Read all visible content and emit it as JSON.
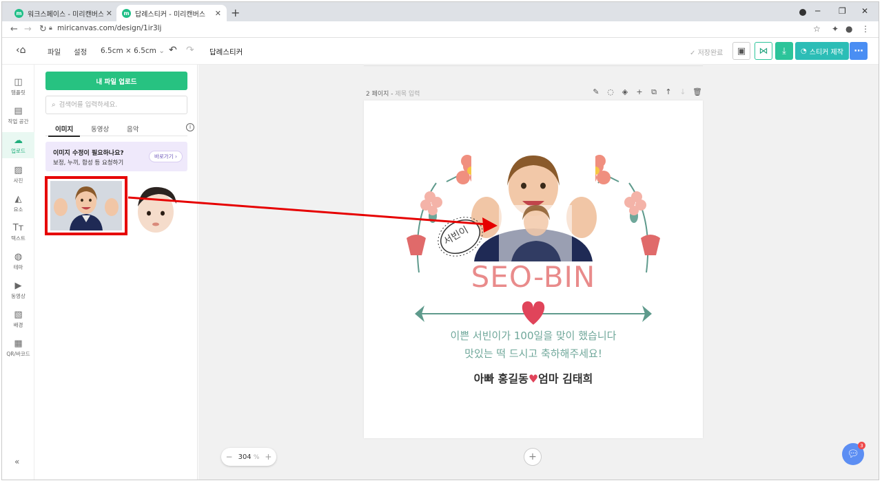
{
  "browser": {
    "tabs": [
      {
        "title": "워크스페이스 - 미리캔버스",
        "active": false
      },
      {
        "title": "답례스티커 - 미리캔버스",
        "active": true
      }
    ],
    "url": "miricanvas.com/design/1ir3lj"
  },
  "toolbar": {
    "file": "파일",
    "settings": "설정",
    "size": "6.5cm × 6.5cm",
    "doc_title": "답례스티커",
    "save_status": "저장완료",
    "sticker_button": "스티커 제작"
  },
  "rail": {
    "items": [
      {
        "label": "템플릿",
        "icon": "template-icon"
      },
      {
        "label": "작업 공간",
        "icon": "workspace-icon"
      },
      {
        "label": "업로드",
        "icon": "upload-icon",
        "active": true
      },
      {
        "label": "사진",
        "icon": "photo-icon"
      },
      {
        "label": "요소",
        "icon": "elements-icon"
      },
      {
        "label": "텍스트",
        "icon": "text-icon"
      },
      {
        "label": "테마",
        "icon": "theme-icon"
      },
      {
        "label": "동영상",
        "icon": "video-icon"
      },
      {
        "label": "배경",
        "icon": "background-icon"
      },
      {
        "label": "QR/바코드",
        "icon": "qr-icon"
      }
    ]
  },
  "panel": {
    "upload_button": "내 파일 업로드",
    "search_placeholder": "검색어를 입력하세요.",
    "tabs": [
      "이미지",
      "동영상",
      "음악"
    ],
    "promo": {
      "title": "이미지 수정이 필요하나요?",
      "subtitle": "보정, 누끼, 합성 등 요청하기",
      "button": "바로가기"
    }
  },
  "canvas": {
    "page_label": "2 페이지",
    "page_title_placeholder": "제목 입력",
    "zoom_value": "304",
    "zoom_unit": "%",
    "chat_badge": "3",
    "sticker": {
      "stamp_text": "서빈이",
      "name": "SEO-BIN",
      "message_line1": "이쁜 서빈이가 100일을 맞이 했습니다",
      "message_line2": "맛있는 떡 드시고 축하해주세요!",
      "message_line3_a": "아빠 홍길동",
      "message_line3_b": "엄마 김태희"
    }
  },
  "colors": {
    "brand_green": "#27c281",
    "accent_blue": "#4a8ef3",
    "annotation_red": "#e60000",
    "sticker_pink": "#e98b8b",
    "sticker_teal": "#5e9a8c"
  }
}
